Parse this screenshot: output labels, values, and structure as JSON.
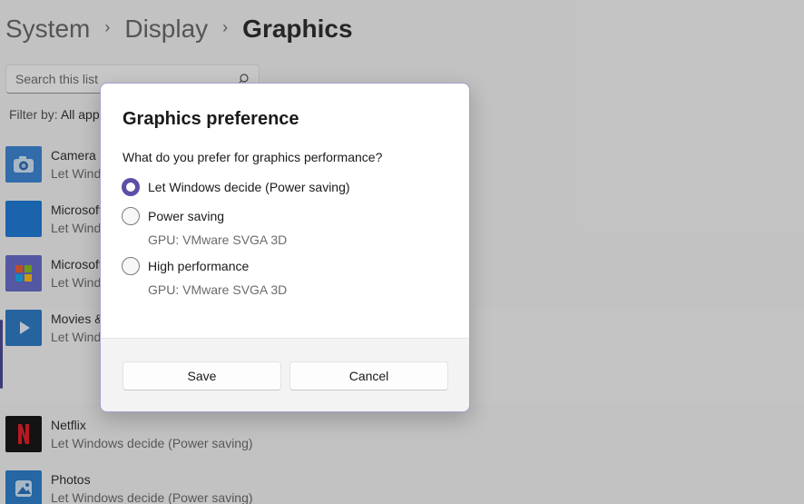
{
  "breadcrumb": {
    "items": [
      "System",
      "Display",
      "Graphics"
    ],
    "separator": "›"
  },
  "search": {
    "placeholder": "Search this list"
  },
  "filter": {
    "label": "Filter by:",
    "value": "All apps"
  },
  "apps": [
    {
      "name": "Camera",
      "status": "Let Windows decide (Power saving)",
      "icon": "camera-icon",
      "color": "#2b7cd3"
    },
    {
      "name": "Microsoft Store",
      "status": "Let Windows decide (Power saving)",
      "icon": "store-icon",
      "color": "#0a6fd6"
    },
    {
      "name": "Microsoft To Do",
      "status": "Let Windows decide (Power saving)",
      "icon": "calendar-icon",
      "color": "#5a5fc7"
    },
    {
      "name": "Movies & TV",
      "status": "Let Windows decide (Power saving)",
      "icon": "play-icon",
      "color": "#1b6fc2"
    },
    {
      "name": "Netflix",
      "status": "Let Windows decide (Power saving)",
      "icon": "netflix-icon",
      "color": "#000000"
    },
    {
      "name": "Photos",
      "status": "Let Windows decide (Power saving)",
      "icon": "photos-icon",
      "color": "#1a73c8"
    }
  ],
  "dialog": {
    "title": "Graphics preference",
    "question": "What do you prefer for graphics performance?",
    "options": [
      {
        "label": "Let Windows decide (Power saving)",
        "checked": true,
        "gpu": ""
      },
      {
        "label": "Power saving",
        "checked": false,
        "gpu": "GPU: VMware SVGA 3D"
      },
      {
        "label": "High performance",
        "checked": false,
        "gpu": "GPU: VMware SVGA 3D"
      }
    ],
    "save_label": "Save",
    "cancel_label": "Cancel",
    "accent_color": "#5b4fa6"
  }
}
